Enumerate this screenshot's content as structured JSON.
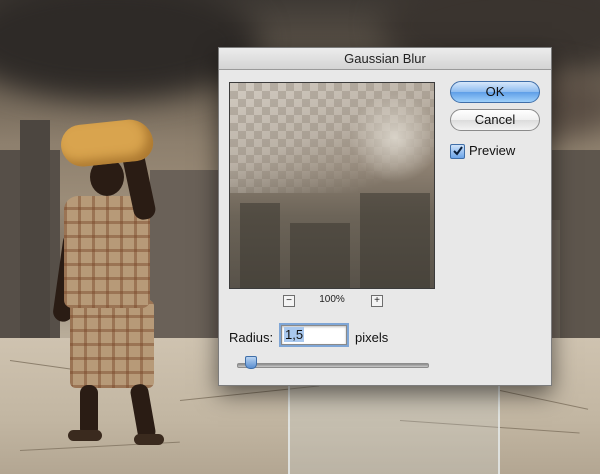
{
  "dialog": {
    "title": "Gaussian Blur",
    "ok_label": "OK",
    "cancel_label": "Cancel",
    "preview_label": "Preview",
    "preview_checked": true,
    "zoom_level": "100%",
    "zoom_out_icon": "minus-icon",
    "zoom_in_icon": "plus-icon",
    "radius_label": "Radius:",
    "radius_value": "1,5",
    "radius_unit": "pixels",
    "slider_icon": "slider-thumb-icon"
  },
  "colors": {
    "default_button": "#5f9ee7",
    "dialog_background": "#e8e8e8",
    "selection_highlight": "#a9c8ee"
  }
}
